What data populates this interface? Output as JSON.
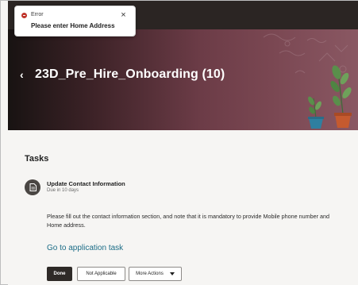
{
  "toast": {
    "label": "Error",
    "message": "Please enter Home Address",
    "close_icon": "×",
    "status_color": "#c0342b"
  },
  "header": {
    "back_icon": "‹",
    "title": "23D_Pre_Hire_Onboarding (10)"
  },
  "tasks": {
    "heading": "Tasks",
    "item": {
      "title": "Update Contact Information",
      "due": "Due in 10 days",
      "description": "Please fill out the contact information section, and note that it is mandatory to provide Mobile phone number and Home address.",
      "link_label": "Go to application task"
    }
  },
  "actions": {
    "done_label": "Done",
    "not_applicable_label": "Not Applicable",
    "more_actions_label": "More Actions"
  },
  "colors": {
    "link": "#1c6d87",
    "banner_dark": "#181312",
    "banner_light": "#8a5863"
  }
}
